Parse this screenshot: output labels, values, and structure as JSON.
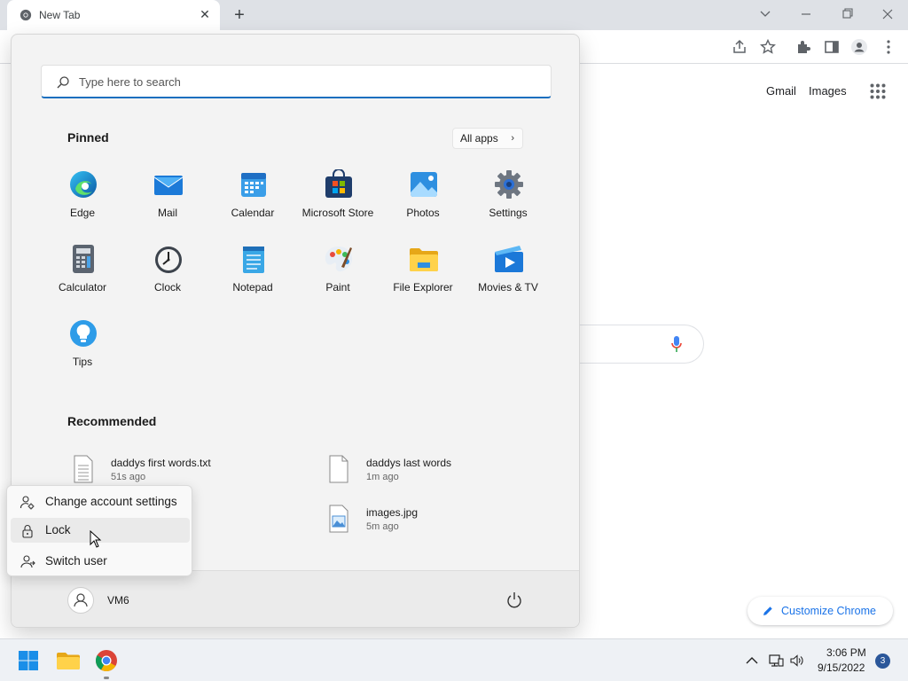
{
  "browser": {
    "tab_title": "New Tab",
    "tab_close": "✕",
    "new_tab": "+"
  },
  "google": {
    "gmail": "Gmail",
    "images": "Images",
    "customize": "Customize Chrome"
  },
  "start_menu": {
    "search_placeholder": "Type here to search",
    "pinned_title": "Pinned",
    "all_apps": "All apps",
    "pinned_apps": [
      {
        "label": "Edge",
        "icon": "edge-icon"
      },
      {
        "label": "Mail",
        "icon": "mail-icon"
      },
      {
        "label": "Calendar",
        "icon": "calendar-icon"
      },
      {
        "label": "Microsoft Store",
        "icon": "store-icon"
      },
      {
        "label": "Photos",
        "icon": "photos-icon"
      },
      {
        "label": "Settings",
        "icon": "settings-icon"
      },
      {
        "label": "Calculator",
        "icon": "calculator-icon"
      },
      {
        "label": "Clock",
        "icon": "clock-icon"
      },
      {
        "label": "Notepad",
        "icon": "notepad-icon"
      },
      {
        "label": "Paint",
        "icon": "paint-icon"
      },
      {
        "label": "File Explorer",
        "icon": "folder-icon"
      },
      {
        "label": "Movies & TV",
        "icon": "movies-icon"
      },
      {
        "label": "Tips",
        "icon": "tips-icon"
      }
    ],
    "recommended_title": "Recommended",
    "recommended": [
      {
        "name": "daddys first words.txt",
        "time": "51s ago"
      },
      {
        "name": "daddys last words",
        "time": "1m ago"
      },
      {
        "name": "images.jpg",
        "time": "5m ago"
      }
    ],
    "user_name": "VM6",
    "account_menu": {
      "change_settings": "Change account settings",
      "lock": "Lock",
      "switch_user": "Switch user"
    }
  },
  "taskbar": {
    "time": "3:06 PM",
    "date": "9/15/2022",
    "notifications": "3"
  },
  "colors": {
    "accent": "#1a6fbf",
    "chrome_blue": "#1a73e8",
    "taskbar_bg": "#eef1f5"
  }
}
